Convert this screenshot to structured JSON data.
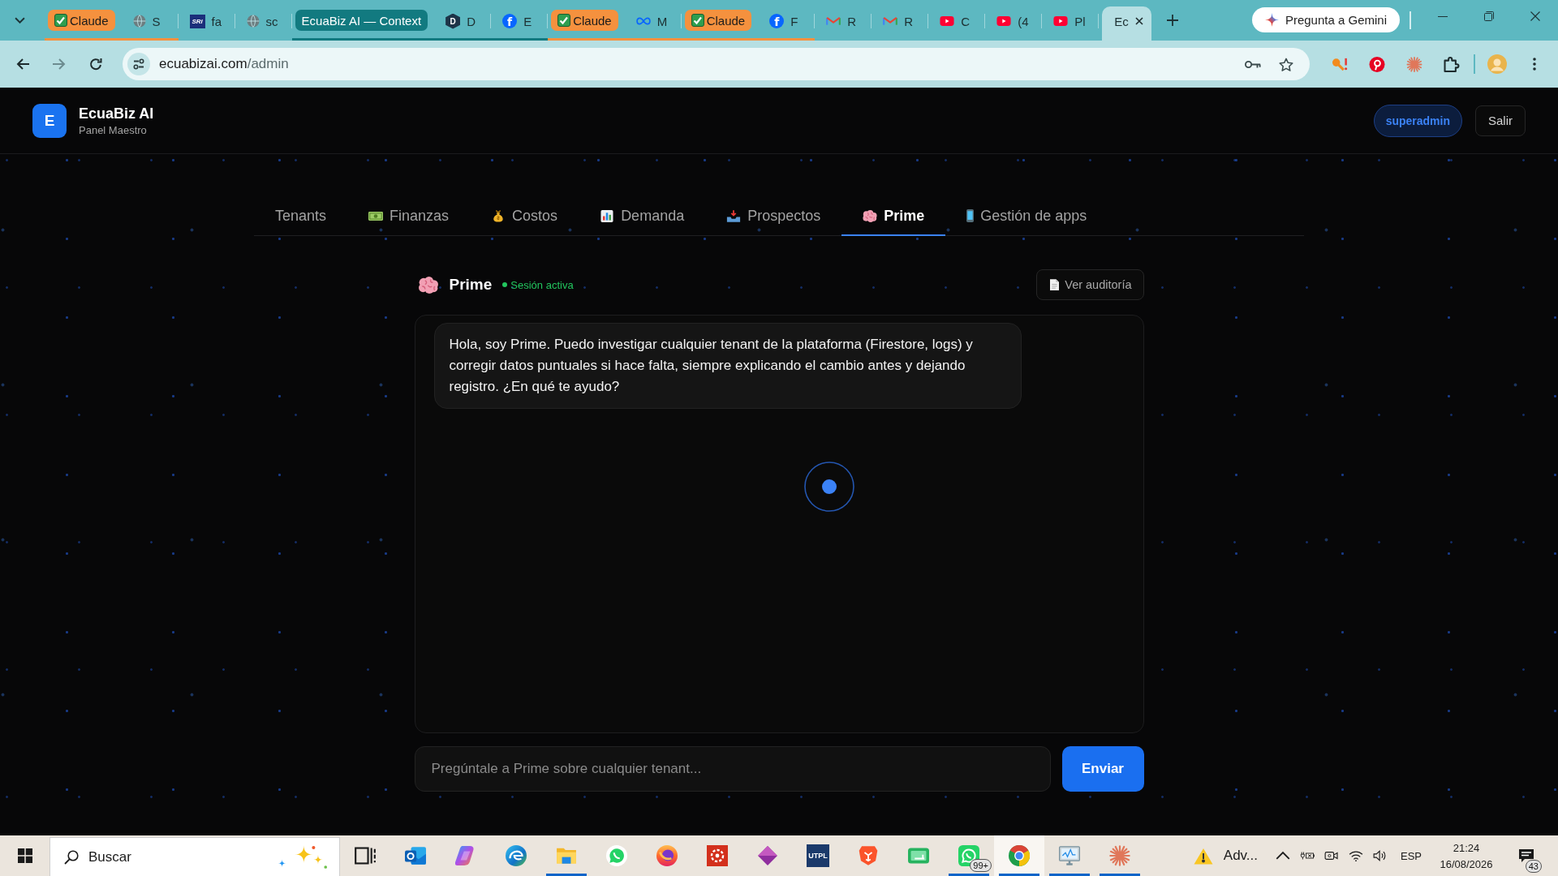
{
  "browser": {
    "tab_strip": [
      {
        "kind": "group",
        "label": "Claude",
        "check_icon": true,
        "color": "#f5913e",
        "tabs": [
          {
            "kind": "globe",
            "label": "S",
            "selected": false
          }
        ]
      },
      {
        "kind": "tile",
        "logo_text": "SRi",
        "label": "fa",
        "selected": false
      },
      {
        "kind": "globe",
        "label": "sc",
        "selected": false
      },
      {
        "kind": "group",
        "label": "EcuaBiz AI — Context",
        "check_icon": false,
        "color": "#127a80",
        "tabs": [
          {
            "kind": "hexagon",
            "logo_text": "D",
            "label": "D",
            "selected": false
          },
          {
            "kind": "fcircle",
            "logo_text": "f",
            "label": "E",
            "selected": false
          }
        ]
      },
      {
        "kind": "group",
        "label": "Claude",
        "check_icon": true,
        "color": "#f5913e",
        "tabs": [
          {
            "kind": "infinity",
            "label": "M",
            "selected": false
          }
        ]
      },
      {
        "kind": "group",
        "label": "Claude",
        "check_icon": true,
        "color": "#f5913e",
        "tabs": [
          {
            "kind": "fcircle",
            "logo_text": "f",
            "label": "F",
            "selected": false
          }
        ]
      },
      {
        "kind": "envelope",
        "label": "R",
        "selected": false
      },
      {
        "kind": "envelope",
        "label": "R",
        "selected": false
      },
      {
        "kind": "play",
        "label": "C",
        "selected": false
      },
      {
        "kind": "play",
        "label": "(4",
        "selected": false
      },
      {
        "kind": "play",
        "label": "Pl",
        "selected": false
      },
      {
        "kind": "plain",
        "label": "Ec",
        "selected": true
      }
    ],
    "gemini_button": "Pregunta a Gemini",
    "nav_buttons": [
      {
        "kind": "back",
        "disabled": false
      },
      {
        "kind": "forward",
        "disabled": true
      },
      {
        "kind": "reload",
        "disabled": false
      }
    ],
    "address": {
      "host": "ecuabizai.com",
      "path": "/admin"
    }
  },
  "app": {
    "brand": {
      "logo_letter": "E",
      "name": "EcuaBiz AI",
      "subtitle": "Panel Maestro"
    },
    "role": "superadmin",
    "logout_button": "Salir",
    "nav_tabs": [
      {
        "kind": "plain",
        "label": "Tenants",
        "selected": false
      },
      {
        "kind": "banknote",
        "label": "Finanzas",
        "selected": false
      },
      {
        "kind": "moneybag",
        "label": "Costos",
        "selected": false
      },
      {
        "kind": "chart",
        "label": "Demanda",
        "selected": false
      },
      {
        "kind": "inbox",
        "label": "Prospectos",
        "selected": false
      },
      {
        "kind": "brain",
        "label": "Prime",
        "selected": true
      },
      {
        "kind": "phone",
        "label": "Gestión de apps",
        "selected": false
      }
    ],
    "assistant": {
      "name": "Prime",
      "online": true,
      "status": "Sesión activa",
      "audit_button": "Ver auditoría",
      "messages": [
        "Hola, soy Prime. Puedo investigar cualquier tenant de la plataforma (Firestore, logs) y corregir datos puntuales si hace falta, siempre explicando el cambio antes y dejando registro. ¿En qué te ayudo?"
      ],
      "loading": true,
      "input": {
        "placeholder": "Pregúntale a Prime sobre cualquier tenant..."
      },
      "send_button": "Enviar"
    }
  },
  "taskbar": {
    "search": {
      "placeholder": "Buscar"
    },
    "apps": [
      {
        "kind": "taskview",
        "running": false,
        "focused": false
      },
      {
        "kind": "mail",
        "running": false,
        "focused": false
      },
      {
        "kind": "swirl",
        "running": false,
        "focused": false
      },
      {
        "kind": "wave",
        "running": false,
        "focused": false
      },
      {
        "kind": "folder",
        "running": true,
        "focused": false
      },
      {
        "kind": "chat",
        "running": false,
        "focused": false
      },
      {
        "kind": "flame",
        "running": false,
        "focused": false
      },
      {
        "kind": "ring",
        "running": false,
        "focused": false
      },
      {
        "kind": "diamond",
        "running": false,
        "focused": false
      },
      {
        "kind": "tile",
        "logo_text": "UTPL",
        "running": false,
        "focused": false
      },
      {
        "kind": "shield",
        "running": false,
        "focused": false
      },
      {
        "kind": "screen",
        "running": false,
        "focused": false
      },
      {
        "kind": "chatsquare",
        "badge": "99+",
        "running": true,
        "focused": false
      },
      {
        "kind": "wheel",
        "running": true,
        "focused": true
      },
      {
        "kind": "monitor",
        "running": true,
        "focused": false
      },
      {
        "kind": "asterisk",
        "running": true,
        "focused": false
      }
    ],
    "weather": "Adv...",
    "language": "ESP",
    "time": "21:24",
    "date": "16/08/2026",
    "notifications": "43"
  }
}
